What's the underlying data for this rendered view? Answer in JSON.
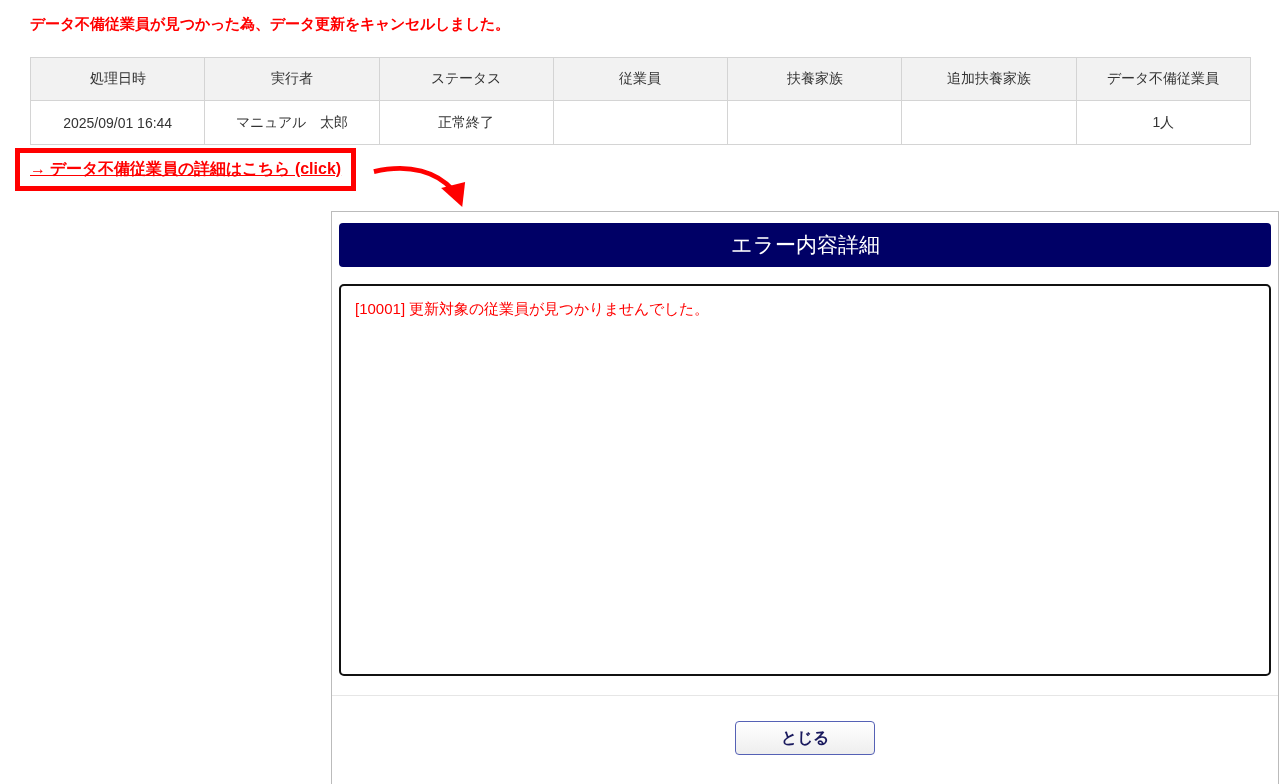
{
  "message": "データ不備従業員が見つかった為、データ更新をキャンセルしました。",
  "table": {
    "columns": [
      "処理日時",
      "実行者",
      "ステータス",
      "従業員",
      "扶養家族",
      "追加扶養家族",
      "データ不備従業員"
    ],
    "rows": [
      [
        "2025/09/01 16:44",
        "マニュアル　太郎",
        "正常終了",
        "",
        "",
        "",
        "1人"
      ]
    ]
  },
  "detail_link": "→ データ不備従業員の詳細はこちら (click)",
  "dialog": {
    "title": "エラー内容詳細",
    "errors": [
      "[10001] 更新対象の従業員が見つかりませんでした。"
    ],
    "buttons": [
      "とじる"
    ]
  }
}
